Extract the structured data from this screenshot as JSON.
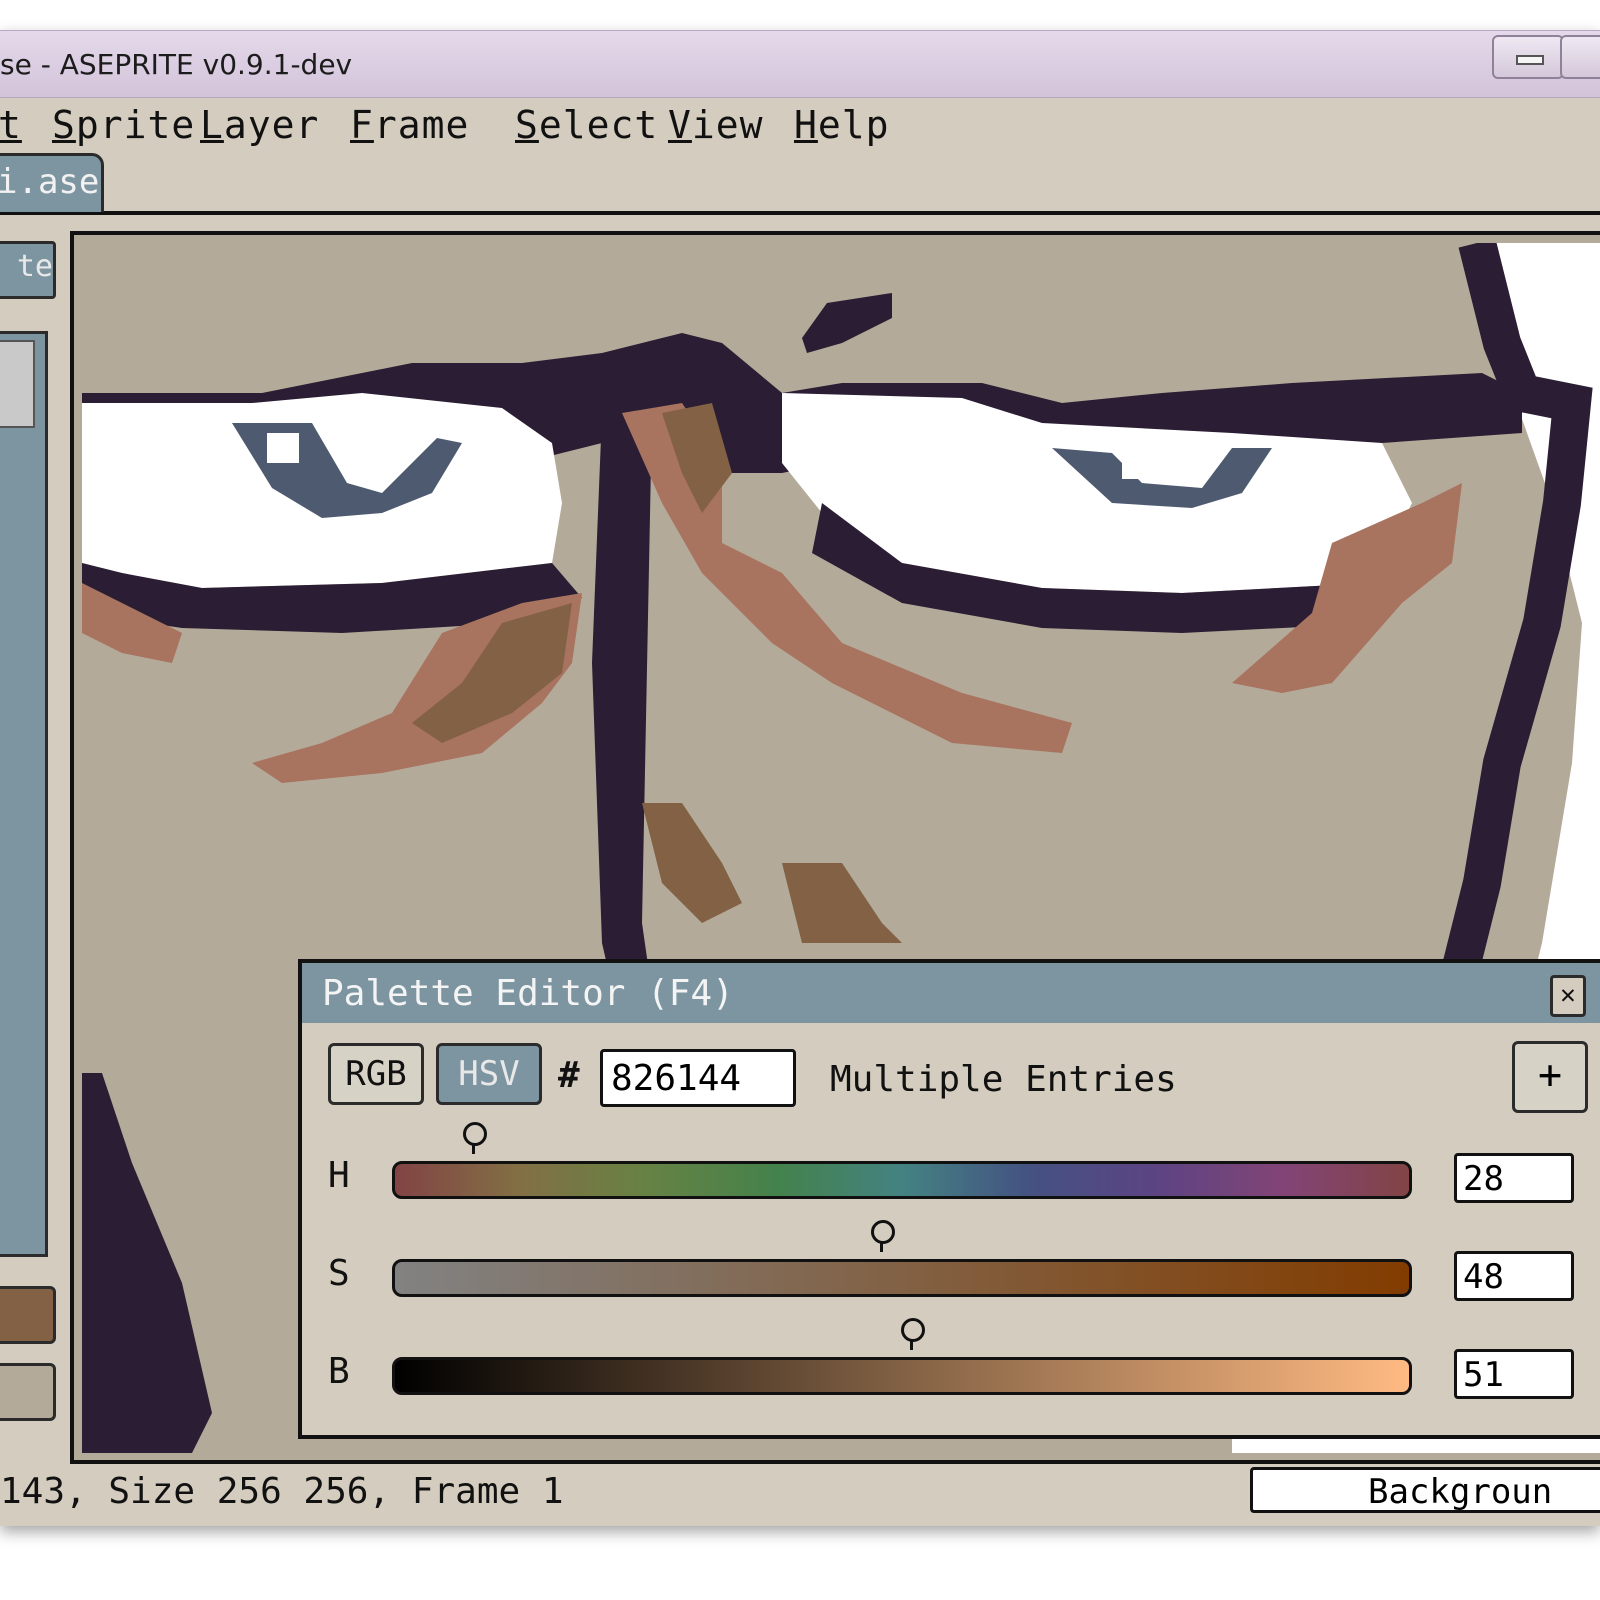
{
  "window": {
    "title": "se - ASEPRITE v0.9.1-dev"
  },
  "menu": [
    {
      "label": "t"
    },
    {
      "label": "Sprite"
    },
    {
      "label": "Layer"
    },
    {
      "label": "Frame"
    },
    {
      "label": "Select"
    },
    {
      "label": "View"
    },
    {
      "label": "Help"
    }
  ],
  "tab": {
    "label": "i.ase"
  },
  "side": {
    "button_label": "te"
  },
  "status": {
    "text": "143, Size 256 256, Frame 1",
    "layer": "Backgroun"
  },
  "palette_editor": {
    "title": "Palette Editor (F4)",
    "close_glyph": "✕",
    "mode_rgb": "RGB",
    "mode_hsv": "HSV",
    "active_mode": "HSV",
    "hash": "#",
    "hex_value": "826144",
    "entries_label": "Multiple Entries",
    "add_glyph": "+",
    "channels": [
      {
        "label": "H",
        "value": "28",
        "fraction": 0.078
      },
      {
        "label": "S",
        "value": "48",
        "fraction": 0.48
      },
      {
        "label": "B",
        "value": "51",
        "fraction": 0.51
      }
    ]
  },
  "colors": {
    "foreground": "#826144",
    "background": "#b4aa99",
    "outline": "#2b1d33",
    "skin_mid": "#a8735f",
    "skin_dark": "#826144",
    "eye_white": "#ffffff",
    "eye_shade": "#4e5a70"
  }
}
